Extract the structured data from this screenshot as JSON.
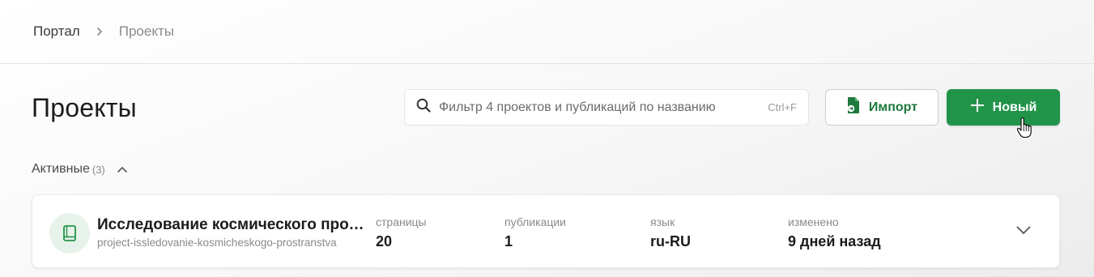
{
  "breadcrumb": {
    "root": "Портал",
    "current": "Проекты"
  },
  "page": {
    "title": "Проекты"
  },
  "search": {
    "placeholder": "Фильтр 4 проектов и публикаций по названию",
    "shortcut": "Ctrl+F"
  },
  "actions": {
    "import_label": "Импорт",
    "new_label": "Новый"
  },
  "colors": {
    "accent": "#22944a",
    "accent_text": "#1e7a3c"
  },
  "section": {
    "title": "Активные",
    "count": "(3)"
  },
  "projects": [
    {
      "name": "Исследование космического пространства",
      "slug": "project-issledovanie-kosmicheskogo-prostranstva",
      "icon": "book-icon",
      "stats": [
        {
          "label": "страницы",
          "value": "20"
        },
        {
          "label": "публикации",
          "value": "1"
        },
        {
          "label": "язык",
          "value": "ru-RU"
        },
        {
          "label": "изменено",
          "value": "9 дней назад"
        }
      ]
    }
  ]
}
